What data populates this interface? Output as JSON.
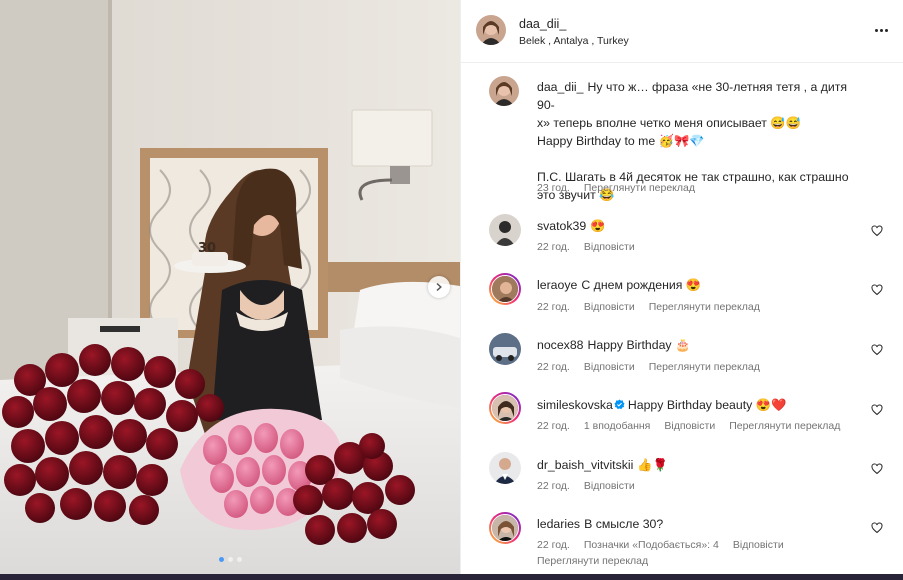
{
  "post": {
    "username": "daa_dii_",
    "location": "Belek , Antalya , Turkey",
    "caption_lines": [
      "Ну что ж… фраза «не 30-летняя тетя , а дитя 90-",
      "х» теперь вполне четко меня описывает 😅😅",
      "Happy Birthday to me 🥳🎀💎",
      "",
      "П.С. Шагать в 4й десяток не так страшно, как страшно",
      "это звучит 😂"
    ],
    "caption_time": "23 год.",
    "caption_translate": "Переглянути переклад",
    "carousel": {
      "slides": 3,
      "active_slide": 1
    }
  },
  "comments": [
    {
      "username": "svatok39",
      "text": "😍",
      "time": "22 год.",
      "actions": [
        "Відповісти"
      ],
      "verified": false
    },
    {
      "username": "leraoye",
      "text": "С днем рождения 😍",
      "time": "22 год.",
      "actions": [
        "Відповісти",
        "Переглянути переклад"
      ],
      "verified": false
    },
    {
      "username": "nocex88",
      "text": "Happy Birthday 🎂",
      "time": "22 год.",
      "actions": [
        "Відповісти",
        "Переглянути переклад"
      ],
      "verified": false
    },
    {
      "username": "simileskovska",
      "text": "Happy Birthday beauty 😍❤️",
      "time": "22 год.",
      "actions": [
        "1 вподобання",
        "Відповісти",
        "Переглянути переклад"
      ],
      "verified": true
    },
    {
      "username": "dr_baish_vitvitskii",
      "text": "👍🌹",
      "time": "22 год.",
      "actions": [
        "Відповісти"
      ],
      "verified": false
    },
    {
      "username": "ledaries",
      "text": "В смысле 30?",
      "time": "22 год.",
      "actions": [
        "Позначки «Подобається»: 4",
        "Відповісти"
      ],
      "second_line": "Переглянути переклад",
      "verified": false
    }
  ],
  "icons": {
    "more": "more-options-icon",
    "heart": "heart-outline-icon",
    "next": "chevron-right-icon",
    "verified": "verified-badge-icon"
  },
  "colors": {
    "verified": "#0095f6",
    "muted": "#737373",
    "text": "#262626",
    "active_dot": "#4a9af5"
  }
}
